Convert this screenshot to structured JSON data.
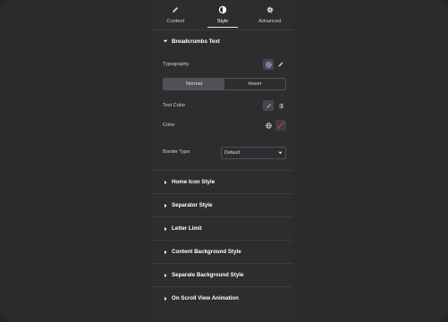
{
  "tabs": [
    {
      "label": "Content",
      "icon": "pencil-icon"
    },
    {
      "label": "Style",
      "icon": "contrast-icon"
    },
    {
      "label": "Advanced",
      "icon": "gear-icon"
    }
  ],
  "section": {
    "title": "Breadcrumbs Text",
    "typography_label": "Typography",
    "states": {
      "normal": "Normal",
      "hover": "Hover"
    },
    "text_color_label": "Text Color",
    "color_label": "Color",
    "border_type_label": "Border Type",
    "border_type_value": "Default"
  },
  "collapsed_sections": [
    "Home Icon Style",
    "Separator Style",
    "Letter Limit",
    "Content Background Style",
    "Separate Background Style",
    "On Scroll View Animation"
  ],
  "colors": {
    "accent_swatch": "#8a4a5a",
    "panel": "#2d2d30",
    "background": "#252527"
  }
}
